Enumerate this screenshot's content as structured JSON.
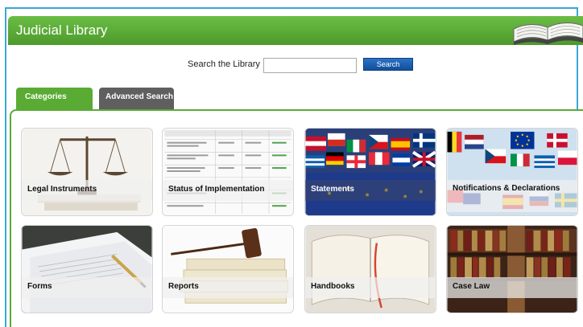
{
  "header": {
    "title": "Judicial Library"
  },
  "search": {
    "label": "Search the Library",
    "value": "",
    "button": "Search"
  },
  "tabs": [
    {
      "label": "Categories",
      "active": true
    },
    {
      "label": "Advanced Search",
      "active": false
    }
  ],
  "categories": [
    {
      "label": "Legal Instruments",
      "icon": "scales-icon"
    },
    {
      "label": "Status of Implementation",
      "icon": "table-document-icon"
    },
    {
      "label": "Statements",
      "icon": "flags-icon"
    },
    {
      "label": "Notifications & Declarations",
      "icon": "flags-icon"
    },
    {
      "label": "Forms",
      "icon": "papers-pen-icon"
    },
    {
      "label": "Reports",
      "icon": "gavel-books-icon"
    },
    {
      "label": "Handbooks",
      "icon": "open-book-icon"
    },
    {
      "label": "Case Law",
      "icon": "bookshelf-icon"
    }
  ],
  "colors": {
    "brand_green": "#5aab34",
    "tab_dark": "#5f5f5f",
    "search_blue": "#1a5fb0",
    "frame_blue": "#3aa7d8"
  }
}
